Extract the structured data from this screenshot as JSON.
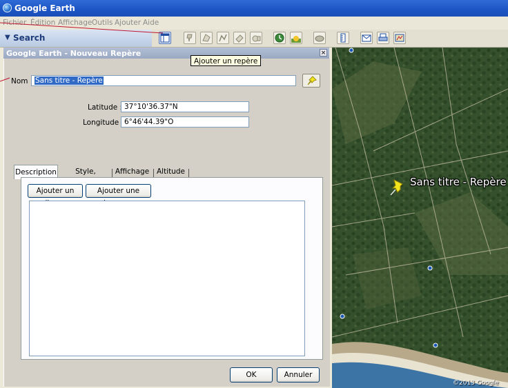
{
  "window": {
    "title": "Google Earth"
  },
  "menu": {
    "items": [
      "Fichier",
      "Édition",
      "Affichage",
      "Outils",
      "Ajouter",
      "Aide"
    ]
  },
  "toolbar": {
    "search_label": "Search",
    "tooltip": "Ajouter un repère",
    "icons": [
      "sidebar-toggle-icon",
      "placemark-add-icon",
      "polygon-add-icon",
      "path-add-icon",
      "overlay-add-icon",
      "tour-record-icon",
      "historical-imagery-icon",
      "sunlight-icon",
      "planets-icon",
      "ruler-icon",
      "email-icon",
      "print-icon",
      "view-in-maps-icon"
    ]
  },
  "dialog": {
    "title": "Google Earth - Nouveau Repère",
    "close_glyph": "×",
    "name_label": "Nom :",
    "name_value": "Sans titre - Repère",
    "latitude_label": "Latitude :",
    "latitude_value": "37°10'36.37\"N",
    "longitude_label": "Longitude :",
    "longitude_value": "6°46'44.39\"O",
    "tabs": [
      "Description",
      "Style, Couleur",
      "Affichage",
      "Altitude"
    ],
    "selected_tab": "Description",
    "add_link_label": "Ajouter un lien...",
    "add_image_label": "Ajouter une image...",
    "description_value": "",
    "ok_label": "OK",
    "cancel_label": "Annuler"
  },
  "map": {
    "placemark_label": "Sans titre - Repère",
    "copyright": "©2013 Google"
  },
  "colors": {
    "titlebar": "#1d55c4",
    "selection": "#316ac5",
    "pin_yellow": "#f3e51d",
    "annotation_line": "#c0152d"
  }
}
